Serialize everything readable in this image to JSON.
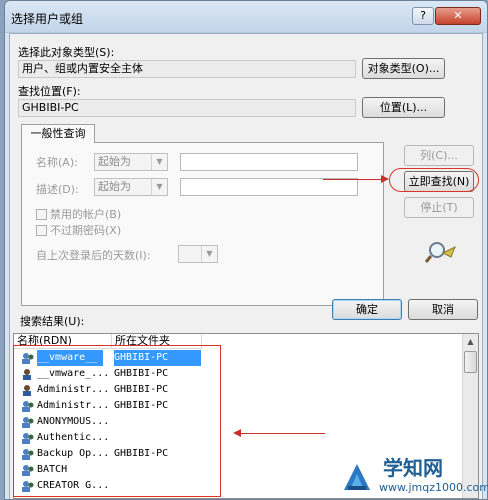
{
  "window": {
    "title": "选择用户或组",
    "help_label": "?",
    "close_label": "✕"
  },
  "object_type": {
    "label": "选择此对象类型(S):",
    "value": "用户、组或内置安全主体",
    "button": "对象类型(O)..."
  },
  "location": {
    "label": "查找位置(F):",
    "value": "GHBIBI-PC",
    "button": "位置(L)..."
  },
  "common_queries": {
    "tab_label": "一般性查询",
    "name_label": "名称(A):",
    "name_combo": "起始为",
    "desc_label": "描述(D):",
    "desc_combo": "起始为",
    "disabled_accounts": "禁用的帐户(B)",
    "non_expiring_pwd": "不过期密码(X)",
    "days_since_logon": "自上次登录后的天数(I):",
    "columns_button": "列(C)...",
    "find_now_button": "立即查找(N)",
    "stop_button": "停止(T)"
  },
  "dialog_buttons": {
    "ok": "确定",
    "cancel": "取消"
  },
  "results": {
    "label": "搜索结果(U):",
    "columns": [
      "名称(RDN)",
      "所在文件夹"
    ],
    "rows": [
      {
        "name": "__vmware__",
        "folder": "GHBIBI-PC"
      },
      {
        "name": "__vmware_...",
        "folder": "GHBIBI-PC"
      },
      {
        "name": "Administr...",
        "folder": "GHBIBI-PC"
      },
      {
        "name": "Administr...",
        "folder": "GHBIBI-PC"
      },
      {
        "name": "ANONYMOUS...",
        "folder": ""
      },
      {
        "name": "Authentic...",
        "folder": ""
      },
      {
        "name": "Backup Op...",
        "folder": "GHBIBI-PC"
      },
      {
        "name": "BATCH",
        "folder": ""
      },
      {
        "name": "CREATOR G...",
        "folder": ""
      }
    ]
  },
  "watermark": {
    "brand": "学知网",
    "url": "www.jmqz1000.com"
  },
  "colors": {
    "annotation_red": "#d8352b",
    "selection_blue": "#3399ff"
  }
}
